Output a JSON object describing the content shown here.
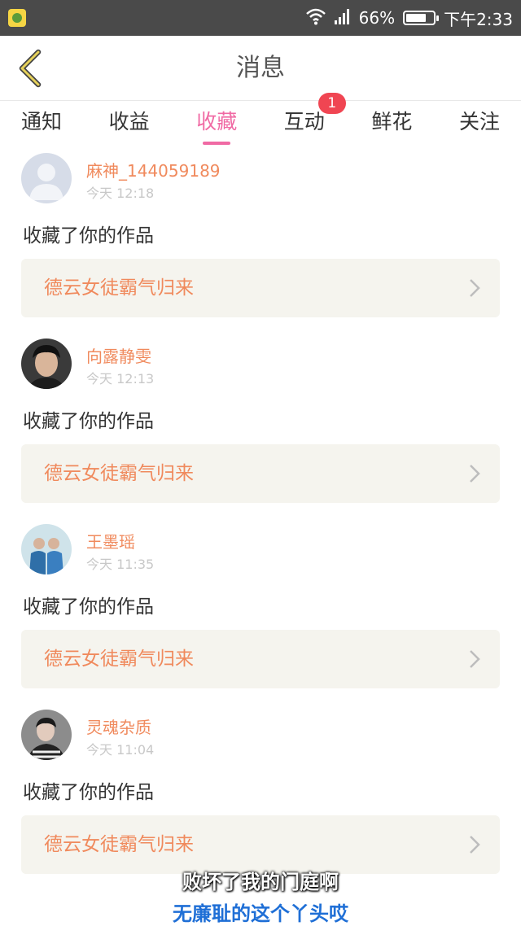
{
  "status_bar": {
    "battery": "66%",
    "time": "下午2:33",
    "icons": [
      "app-icon",
      "wifi-icon",
      "signal-icon",
      "battery-icon"
    ]
  },
  "nav": {
    "title": "消息",
    "back_icon": "chevron-left-icon"
  },
  "tabs": [
    {
      "label": "通知"
    },
    {
      "label": "收益"
    },
    {
      "label": "收藏",
      "active": true
    },
    {
      "label": "互动",
      "badge": "1"
    },
    {
      "label": "鲜花"
    },
    {
      "label": "关注"
    }
  ],
  "items": [
    {
      "user": "麻神_144059189",
      "time": "今天 12:18",
      "action": "收藏了你的作品",
      "work": "德云女徒霸气归来",
      "avatar": "default-avatar"
    },
    {
      "user": "向露静雯",
      "time": "今天 12:13",
      "action": "收藏了你的作品",
      "work": "德云女徒霸气归来",
      "avatar": "photo-avatar"
    },
    {
      "user": "王墨瑶",
      "time": "今天 11:35",
      "action": "收藏了你的作品",
      "work": "德云女徒霸气归来",
      "avatar": "photo-avatar"
    },
    {
      "user": "灵魂杂质",
      "time": "今天 11:04",
      "action": "收藏了你的作品",
      "work": "德云女徒霸气归来",
      "avatar": "photo-avatar"
    }
  ],
  "subtitles": [
    "败坏了我的门庭啊",
    "无廉耻的这个丫头哎"
  ],
  "colors": {
    "accent_pink": "#f06aa4",
    "username_orange": "#f08a5d",
    "badge_red": "#f04552",
    "work_box_bg": "#f5f4ee",
    "status_bar_bg": "#4a4a4a",
    "back_arrow": "#c9b23a"
  }
}
